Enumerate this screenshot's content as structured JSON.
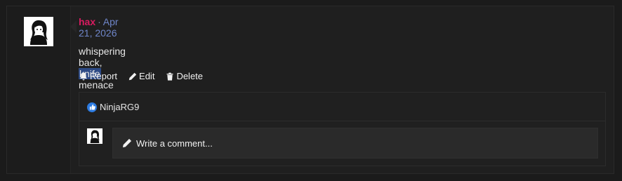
{
  "post": {
    "author": "hax",
    "separator": "·",
    "date": "Apr 21, 2026",
    "message_before": "whispering back, ",
    "message_highlight": "knife",
    "message_after": " menace",
    "actions": {
      "report": "Report",
      "edit": "Edit",
      "delete": "Delete"
    }
  },
  "reactions": {
    "users": "NinjaRG9",
    "icon": "thumbs-up-icon"
  },
  "comment": {
    "placeholder": "Write a comment..."
  },
  "colors": {
    "author": "#d81b60",
    "date": "#6f86c9",
    "highlight": "#2d4a85",
    "like": "#2d7be0"
  }
}
